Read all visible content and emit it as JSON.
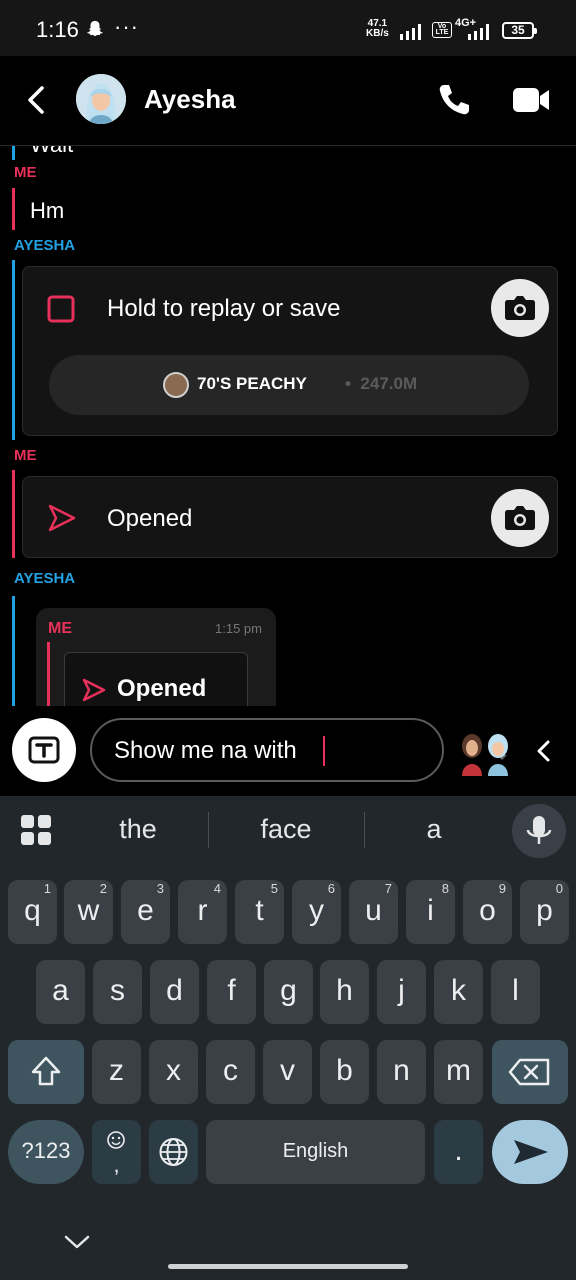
{
  "status_bar": {
    "time": "1:16",
    "more": "···",
    "net_speed_value": "47.1",
    "net_speed_unit": "KB/s",
    "network": "4G+",
    "battery": "35"
  },
  "header": {
    "contact_name": "Ayesha"
  },
  "chat": {
    "partial_text": "Wait",
    "messages": [
      {
        "sender": "ME",
        "text": "Hm"
      },
      {
        "sender": "AYESHA",
        "snap_label": "Hold to replay or save",
        "lens_name": "70'S PEACHY",
        "lens_sep": "•",
        "lens_count": "247.0M"
      },
      {
        "sender": "ME",
        "snap_label": "Opened"
      },
      {
        "sender": "AYESHA",
        "reply_sender": "ME",
        "reply_time": "1:15 pm",
        "reply_label": "Opened"
      }
    ]
  },
  "composer": {
    "value": "Show me na with"
  },
  "keyboard": {
    "suggestions": [
      "the",
      "face",
      "a"
    ],
    "row1": [
      {
        "k": "q",
        "h": "1"
      },
      {
        "k": "w",
        "h": "2"
      },
      {
        "k": "e",
        "h": "3"
      },
      {
        "k": "r",
        "h": "4"
      },
      {
        "k": "t",
        "h": "5"
      },
      {
        "k": "y",
        "h": "6"
      },
      {
        "k": "u",
        "h": "7"
      },
      {
        "k": "i",
        "h": "8"
      },
      {
        "k": "o",
        "h": "9"
      },
      {
        "k": "p",
        "h": "0"
      }
    ],
    "row2": [
      "a",
      "s",
      "d",
      "f",
      "g",
      "h",
      "j",
      "k",
      "l"
    ],
    "row3": [
      "z",
      "x",
      "c",
      "v",
      "b",
      "n",
      "m"
    ],
    "symbols_label": "?123",
    "emoji_comma": ",",
    "space_label": "English",
    "period": "."
  },
  "colors": {
    "me": "#e8315a",
    "ayesha": "#22a1e3",
    "keyboard_bg": "#22272c"
  }
}
